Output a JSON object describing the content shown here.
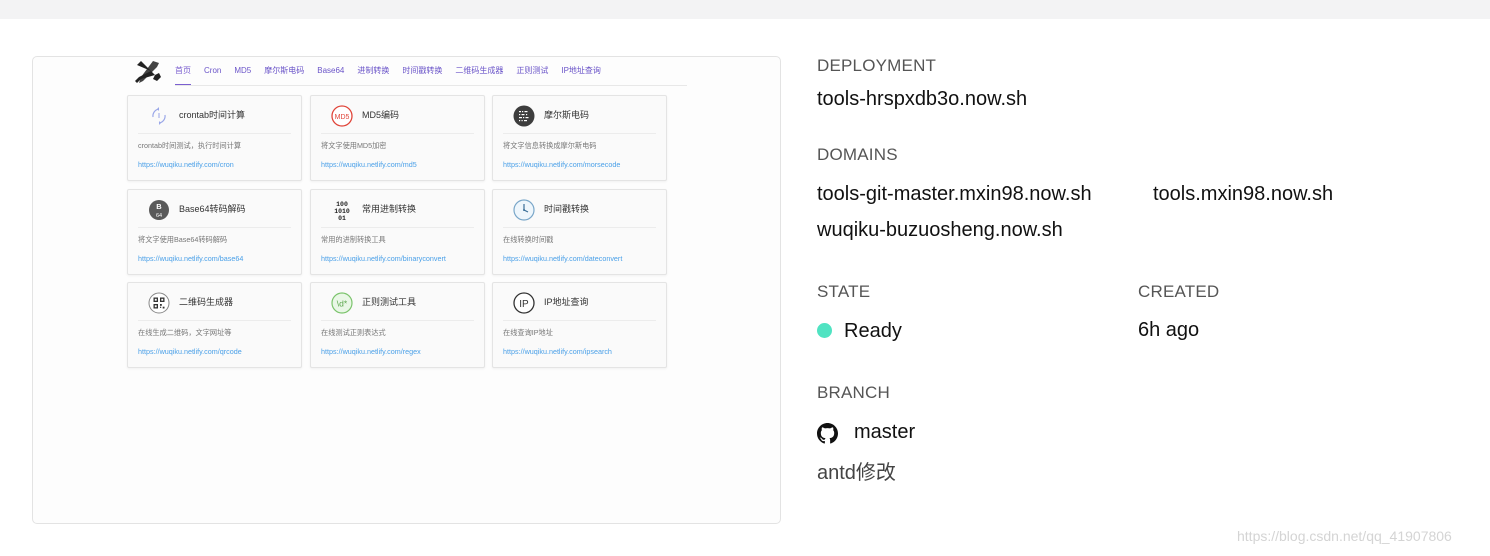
{
  "preview": {
    "nav": [
      "首页",
      "Cron",
      "MD5",
      "摩尔斯电码",
      "Base64",
      "进制转换",
      "时间戳转换",
      "二维码生成器",
      "正则测试",
      "IP地址查询"
    ],
    "cards": [
      {
        "title": "crontab时间计算",
        "desc": "crontab时间测试，执行时间计算",
        "link": "https://wuqiku.netlify.com/cron",
        "icon": "clock-arrows-icon"
      },
      {
        "title": "MD5编码",
        "desc": "将文字使用MD5加密",
        "link": "https://wuqiku.netlify.com/md5",
        "icon": "md5-icon",
        "icon_text": "MD5"
      },
      {
        "title": "摩尔斯电码",
        "desc": "将文字信息转换成摩尔斯电码",
        "link": "https://wuqiku.netlify.com/morsecode",
        "icon": "morse-icon"
      },
      {
        "title": "Base64转码解码",
        "desc": "将文字使用Base64转码解码",
        "link": "https://wuqiku.netlify.com/base64",
        "icon": "base64-icon",
        "icon_text_top": "B",
        "icon_text_bottom": "64"
      },
      {
        "title": "常用进制转换",
        "desc": "常用的进制转换工具",
        "link": "https://wuqiku.netlify.com/binaryconvert",
        "icon": "binary-icon",
        "icon_lines": [
          "100",
          "1010",
          "01"
        ]
      },
      {
        "title": "时间戳转换",
        "desc": "在线转换时间戳",
        "link": "https://wuqiku.netlify.com/dateconvert",
        "icon": "timestamp-icon"
      },
      {
        "title": "二维码生成器",
        "desc": "在线生成二维码，文字网址等",
        "link": "https://wuqiku.netlify.com/qrcode",
        "icon": "qrcode-icon"
      },
      {
        "title": "正则测试工具",
        "desc": "在线测试正则表达式",
        "link": "https://wuqiku.netlify.com/regex",
        "icon": "regex-icon",
        "icon_text": "\\d*"
      },
      {
        "title": "IP地址查询",
        "desc": "在线查询IP地址",
        "link": "https://wuqiku.netlify.com/ipsearch",
        "icon": "ip-icon",
        "icon_text": "IP"
      }
    ]
  },
  "info": {
    "deployment_label": "DEPLOYMENT",
    "deployment": "tools-hrspxdb3o.now.sh",
    "domains_label": "DOMAINS",
    "domains": [
      "tools-git-master.mxin98.now.sh",
      "tools.mxin98.now.sh",
      "wuqiku-buzuosheng.now.sh"
    ],
    "state_label": "STATE",
    "state": "Ready",
    "state_color": "#50e3c2",
    "created_label": "CREATED",
    "created": "6h ago",
    "branch_label": "BRANCH",
    "branch": "master",
    "commit_message": "antd修改"
  },
  "watermark": "https://blog.csdn.net/qq_41907806"
}
